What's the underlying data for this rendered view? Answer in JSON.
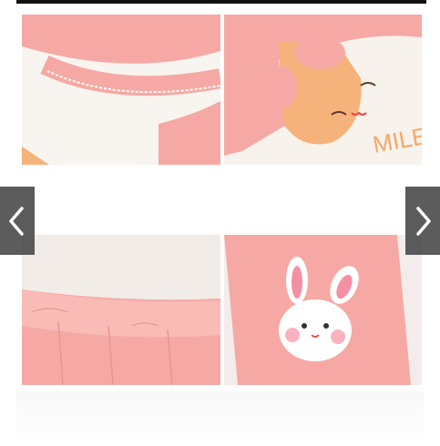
{
  "gallery": {
    "images": [
      {
        "alt": ""
      },
      {
        "alt": ""
      },
      {
        "alt": ""
      },
      {
        "alt": ""
      }
    ],
    "prev_icon": "chevron-left-icon",
    "next_icon": "chevron-right-icon"
  },
  "print_text": "MILE",
  "colors": {
    "pink": "#f6a9a4",
    "pink_light": "#f9c4bf",
    "cream": "#f7f2ec",
    "face_orange": "#f5b27a",
    "nav_bg": "#474747"
  }
}
